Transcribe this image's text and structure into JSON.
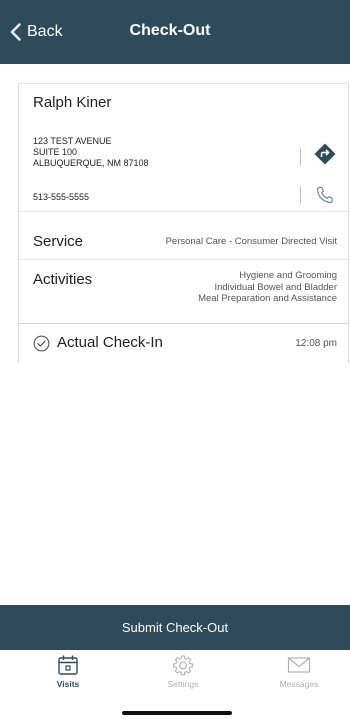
{
  "header": {
    "back_label": "Back",
    "title": "Check-Out"
  },
  "client": {
    "name": "Ralph Kiner",
    "address_lines": [
      "123 TEST AVENUE",
      "SUITE 100",
      "ALBUQUERQUE, NM 87108"
    ],
    "phone": "513-555-5555"
  },
  "service": {
    "label": "Service",
    "value": "Personal Care - Consumer Directed Visit"
  },
  "activities": {
    "label": "Activities",
    "items": [
      "Hygiene and Grooming",
      "Individual Bowel and Bladder",
      "Meal Preparation and Assistance"
    ]
  },
  "checkin": {
    "label": "Actual Check-In",
    "time": "12:08 pm"
  },
  "submit": {
    "label": "Submit Check-Out"
  },
  "tabs": [
    {
      "label": "Visits",
      "icon": "calendar-icon",
      "active": true
    },
    {
      "label": "Settings",
      "icon": "gear-icon",
      "active": false
    },
    {
      "label": "Messages",
      "icon": "envelope-icon",
      "active": false
    }
  ],
  "colors": {
    "primary": "#2e4a5b",
    "directions_icon": "#2e4a5b",
    "phone_icon": "#6d8a96",
    "inactive_tab": "#b0b0b0"
  }
}
